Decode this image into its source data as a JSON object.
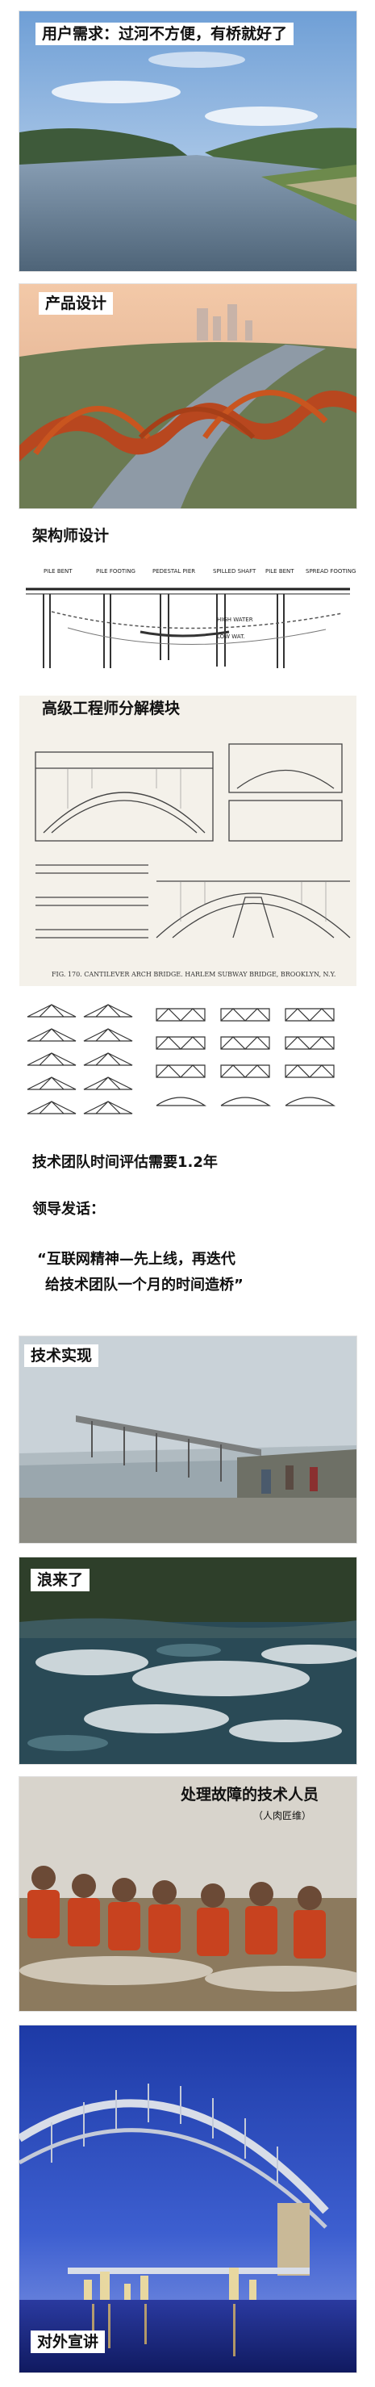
{
  "panels": {
    "user_need": "用户需求：过河不方便，有桥就好了",
    "product_design": "产品设计",
    "architect_design": "架构师设计",
    "senior_engineer": "高级工程师分解模块",
    "tech_impl": "技术实现",
    "wave": "浪来了",
    "fixers": "处理故障的技术人员",
    "fixers_sub": "（人肉匠维）",
    "promo": "对外宣讲"
  },
  "text": {
    "estimate": "技术团队时间评估需要1.2年",
    "leader": "领导发话：",
    "quote_line1": "“互联网精神—先上线，再迭代",
    "quote_line2": "给技术团队一个月的时间造桥”"
  },
  "drawing_labels": {
    "architect": [
      "PILE BENT",
      "PILE FOOTING",
      "PEDESTAL PIER",
      "SPILLED SHAFT",
      "PILE BENT",
      "SPREAD FOOTING",
      "HIGH WATER",
      "LOW WAT."
    ],
    "senior_caption": "FIG. 170.  CANTILEVER ARCH BRIDGE.  HARLEM SUBWAY BRIDGE, BROOKLYN, N.Y."
  }
}
